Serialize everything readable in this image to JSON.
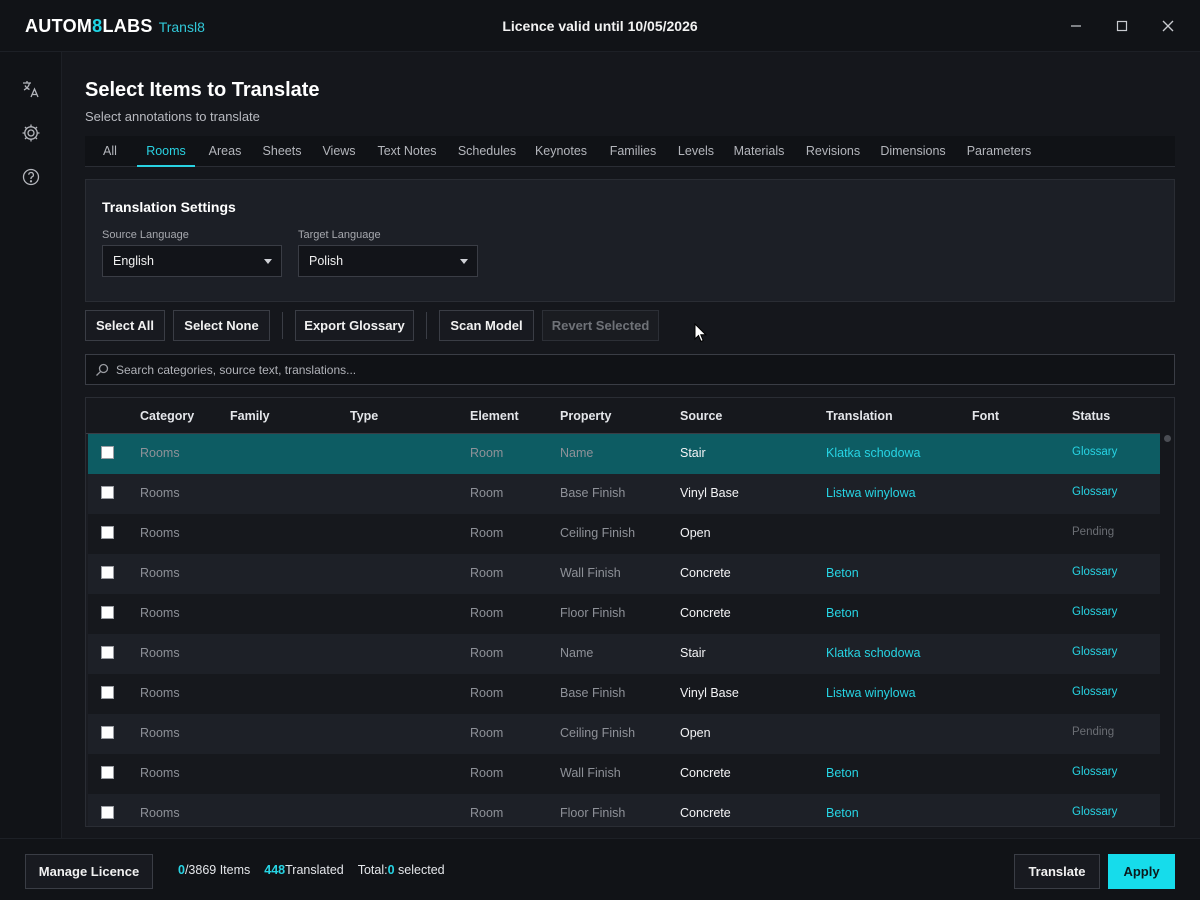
{
  "app": {
    "brand_prefix": "AUTOM",
    "brand_eight": "8",
    "brand_suffix": "LABS",
    "product": "Transl8",
    "licence_title": "Licence valid until 10/05/2026"
  },
  "window_controls": [
    "minimize-icon",
    "maximize-icon",
    "close-icon"
  ],
  "sidebar": {
    "icons": [
      "translate-icon",
      "gear-icon",
      "help-icon"
    ]
  },
  "page": {
    "title": "Select Items to Translate",
    "subtitle": "Select annotations to translate"
  },
  "tabs": [
    {
      "label": "All"
    },
    {
      "label": "Rooms",
      "active": true
    },
    {
      "label": "Areas"
    },
    {
      "label": "Sheets"
    },
    {
      "label": "Views"
    },
    {
      "label": "Text Notes"
    },
    {
      "label": "Schedules"
    },
    {
      "label": "Keynotes"
    },
    {
      "label": "Families"
    },
    {
      "label": "Levels"
    },
    {
      "label": "Materials"
    },
    {
      "label": "Revisions"
    },
    {
      "label": "Dimensions"
    },
    {
      "label": "Parameters"
    }
  ],
  "settings": {
    "title": "Translation Settings",
    "source_label": "Source Language",
    "source_value": "English",
    "target_label": "Target Language",
    "target_value": "Polish"
  },
  "toolbar": {
    "select_all": "Select All",
    "select_none": "Select None",
    "export_glossary": "Export Glossary",
    "scan_model": "Scan Model",
    "revert_selected": "Revert Selected"
  },
  "search": {
    "placeholder": "Search categories, source text, translations..."
  },
  "table": {
    "columns": [
      "Category",
      "Family",
      "Type",
      "Element",
      "Property",
      "Source",
      "Translation",
      "Font",
      "Status"
    ],
    "rows": [
      {
        "category": "Rooms",
        "family": "",
        "type": "",
        "element": "Room",
        "property": "Name",
        "source": "Stair",
        "translation": "Klatka schodowa",
        "font": "",
        "status": "Glossary",
        "selected": true
      },
      {
        "category": "Rooms",
        "family": "",
        "type": "",
        "element": "Room",
        "property": "Base Finish",
        "source": "Vinyl Base",
        "translation": "Listwa winylowa",
        "font": "",
        "status": "Glossary"
      },
      {
        "category": "Rooms",
        "family": "",
        "type": "",
        "element": "Room",
        "property": "Ceiling Finish",
        "source": "Open",
        "translation": "",
        "font": "",
        "status": "Pending"
      },
      {
        "category": "Rooms",
        "family": "",
        "type": "",
        "element": "Room",
        "property": "Wall Finish",
        "source": "Concrete",
        "translation": "Beton",
        "font": "",
        "status": "Glossary"
      },
      {
        "category": "Rooms",
        "family": "",
        "type": "",
        "element": "Room",
        "property": "Floor Finish",
        "source": "Concrete",
        "translation": "Beton",
        "font": "",
        "status": "Glossary"
      },
      {
        "category": "Rooms",
        "family": "",
        "type": "",
        "element": "Room",
        "property": "Name",
        "source": "Stair",
        "translation": "Klatka schodowa",
        "font": "",
        "status": "Glossary"
      },
      {
        "category": "Rooms",
        "family": "",
        "type": "",
        "element": "Room",
        "property": "Base Finish",
        "source": "Vinyl Base",
        "translation": "Listwa winylowa",
        "font": "",
        "status": "Glossary"
      },
      {
        "category": "Rooms",
        "family": "",
        "type": "",
        "element": "Room",
        "property": "Ceiling Finish",
        "source": "Open",
        "translation": "",
        "font": "",
        "status": "Pending"
      },
      {
        "category": "Rooms",
        "family": "",
        "type": "",
        "element": "Room",
        "property": "Wall Finish",
        "source": "Concrete",
        "translation": "Beton",
        "font": "",
        "status": "Glossary"
      },
      {
        "category": "Rooms",
        "family": "",
        "type": "",
        "element": "Room",
        "property": "Floor Finish",
        "source": "Concrete",
        "translation": "Beton",
        "font": "",
        "status": "Glossary"
      }
    ]
  },
  "footer": {
    "manage_licence": "Manage Licence",
    "selected_count": "0",
    "total_items": "/3869",
    "items_label": " Items",
    "translated_count": "448",
    "translated_label": "Translated",
    "total_label": "Total:",
    "total_selected": "0",
    "selected_label": " selected",
    "translate": "Translate",
    "apply": "Apply"
  },
  "colors": {
    "accent": "#27d4e4",
    "selected_row": "#0d5c63",
    "background": "#15171c"
  }
}
